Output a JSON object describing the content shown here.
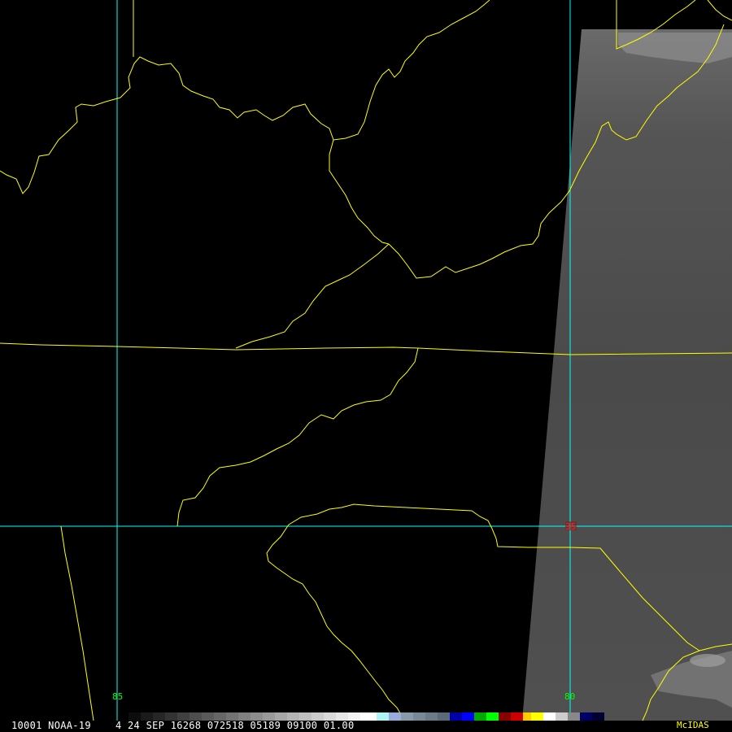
{
  "status": {
    "frame": "1",
    "image_id": "0001",
    "satellite": "NOAA-19",
    "band": "4",
    "date": "24 SEP 16268",
    "time": "072518",
    "line_element": "05189 09100",
    "magnification": "01.00"
  },
  "grid": {
    "longitudes": [
      {
        "label": "85",
        "color": "#00ff00"
      },
      {
        "label": "80",
        "color": "#00ff00"
      }
    ],
    "latitude_marker": {
      "label": "35",
      "color": "#ff2020"
    }
  },
  "colors": {
    "boundaries": "#ffff00",
    "graticule": "#00ffff",
    "background": "#000000",
    "imagery": "#4a4a4a"
  },
  "brand": {
    "name": "McIDAS",
    "color": "#ffff00"
  }
}
